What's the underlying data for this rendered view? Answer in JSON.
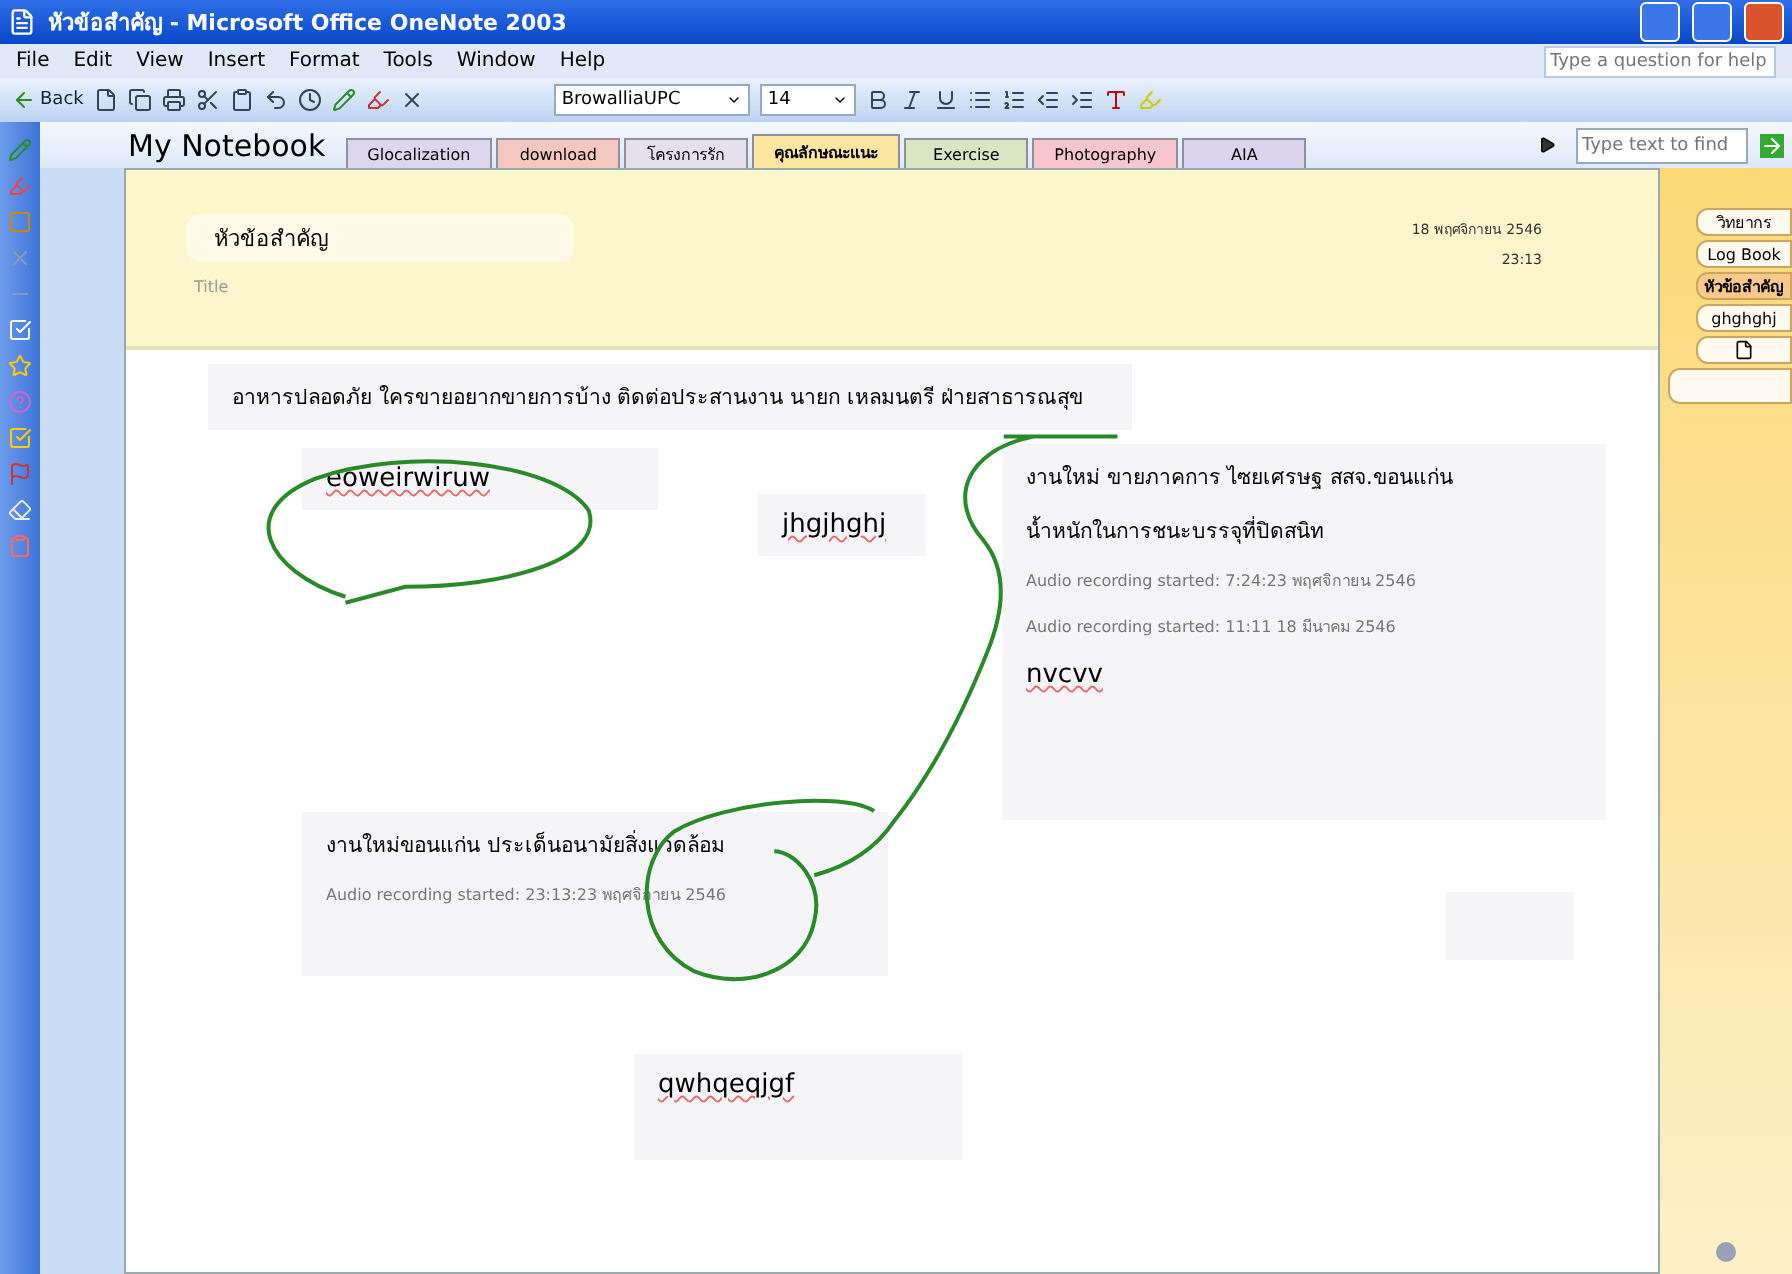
{
  "window": {
    "title": "หัวข้อสำคัญ - Microsoft Office OneNote 2003"
  },
  "menu": [
    "File",
    "Edit",
    "View",
    "Insert",
    "Format",
    "Tools",
    "Window",
    "Help"
  ],
  "help_box": {
    "placeholder": "Type a question for help"
  },
  "toolbar": {
    "back_label": "Back",
    "font": "BrowalliaUPC",
    "size": "14"
  },
  "notebook": {
    "name": "My Notebook",
    "sections": [
      {
        "label": "Glocalization",
        "color": "#dcd6ee",
        "selected": false
      },
      {
        "label": "download",
        "color": "#f4c8c0",
        "selected": false
      },
      {
        "label": "โครงการรัก",
        "color": "#e4e0ee",
        "selected": false
      },
      {
        "label": "คุณลักษณะแนะ",
        "color": "#fbe6a0",
        "selected": true
      },
      {
        "label": "Exercise",
        "color": "#d8e6c4",
        "selected": false
      },
      {
        "label": "Photography",
        "color": "#f6c6cc",
        "selected": false
      },
      {
        "label": "AIA",
        "color": "#dcd4ee",
        "selected": false
      }
    ]
  },
  "find": {
    "placeholder": "Type text to find"
  },
  "page": {
    "title": "หัวข้อสำคัญ",
    "title_label": "Title",
    "date": "18 พฤศจิกายน 2546",
    "time": "23:13"
  },
  "notes": [
    {
      "kind": "text",
      "lines": [
        {
          "kind": "body",
          "text": "อาหารปลอดภัย ใครขายอยากขายการบ้าง ติดต่อประสานงาน นายก เหลมนตรี ฝ่ายสาธารณสุข"
        }
      ]
    },
    {
      "kind": "text",
      "lines": [
        {
          "kind": "large",
          "text": "eoweirwiruw"
        }
      ]
    },
    {
      "kind": "text",
      "lines": [
        {
          "kind": "large",
          "text": "jhgjhghj"
        }
      ]
    },
    {
      "kind": "text",
      "lines": [
        {
          "kind": "body",
          "text": "งานใหม่ ขายภาคการ ไซยเศรษฐ สสจ.ขอนแก่น"
        },
        {
          "kind": "body",
          "text": "น้ำหนักในการชนะบรรจุที่ปิดสนิท"
        },
        {
          "kind": "audio",
          "text": "Audio recording started: 7:24:23 พฤศจิกายน 2546"
        },
        {
          "kind": "audio",
          "text": "Audio recording started: 11:11 18 มีนาคม 2546"
        },
        {
          "kind": "large",
          "text": "nvcvv"
        }
      ]
    },
    {
      "kind": "text",
      "lines": [
        {
          "kind": "body",
          "text": "งานใหม่ขอนแก่น ประเด็นอนามัยสิ่งแวดล้อม"
        },
        {
          "kind": "audio",
          "text": "Audio recording started: 23:13:23 พฤศจิกายน 2546"
        }
      ]
    },
    {
      "kind": "text",
      "lines": [
        {
          "kind": "large",
          "text": "qwhqeqjgf"
        }
      ]
    },
    {
      "kind": "empty"
    }
  ],
  "page_tabs": [
    {
      "kind": "text",
      "label": "วิทยากร",
      "selected": false
    },
    {
      "kind": "text",
      "label": "Log Book",
      "selected": false
    },
    {
      "kind": "text",
      "label": "หัวข้อสำคัญ",
      "selected": true
    },
    {
      "kind": "text",
      "label": "ghghghj",
      "selected": false
    },
    {
      "kind": "new",
      "selected": false
    },
    {
      "kind": "blank",
      "selected": false
    }
  ]
}
